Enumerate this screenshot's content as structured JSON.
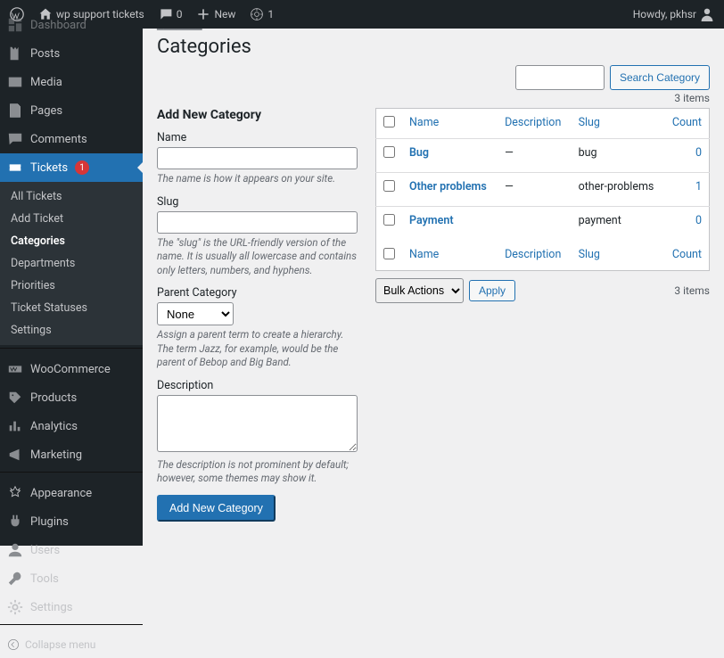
{
  "adminbar": {
    "site_name": "wp support tickets",
    "comments_count": "0",
    "new_label": "New",
    "user_count": "1",
    "greeting": "Howdy, pkhsr"
  },
  "sidebar": {
    "items": [
      {
        "label": "Dashboard",
        "icon": "dashboard"
      },
      {
        "label": "Posts",
        "icon": "posts"
      },
      {
        "label": "Media",
        "icon": "media"
      },
      {
        "label": "Pages",
        "icon": "pages"
      },
      {
        "label": "Comments",
        "icon": "comments"
      },
      {
        "label": "Tickets",
        "icon": "tickets",
        "badge": "1",
        "current": true
      }
    ],
    "submenu": [
      {
        "label": "All Tickets"
      },
      {
        "label": "Add Ticket"
      },
      {
        "label": "Categories",
        "current": true
      },
      {
        "label": "Departments"
      },
      {
        "label": "Priorities"
      },
      {
        "label": "Ticket Statuses"
      },
      {
        "label": "Settings"
      }
    ],
    "items2": [
      {
        "label": "WooCommerce",
        "icon": "woo"
      },
      {
        "label": "Products",
        "icon": "products"
      },
      {
        "label": "Analytics",
        "icon": "analytics"
      },
      {
        "label": "Marketing",
        "icon": "marketing"
      }
    ],
    "items3": [
      {
        "label": "Appearance",
        "icon": "appearance"
      },
      {
        "label": "Plugins",
        "icon": "plugins"
      },
      {
        "label": "Users",
        "icon": "users"
      },
      {
        "label": "Tools",
        "icon": "tools"
      },
      {
        "label": "Settings",
        "icon": "settings"
      }
    ],
    "collapse": "Collapse menu"
  },
  "page": {
    "title": "Categories",
    "cut_item": "Dashboard",
    "search_button": "Search Category",
    "items_count": "3 items",
    "form": {
      "heading": "Add New Category",
      "name_label": "Name",
      "name_desc": "The name is how it appears on your site.",
      "slug_label": "Slug",
      "slug_desc": "The \"slug\" is the URL-friendly version of the name. It is usually all lowercase and contains only letters, numbers, and hyphens.",
      "parent_label": "Parent Category",
      "parent_selected": "None",
      "parent_desc": "Assign a parent term to create a hierarchy. The term Jazz, for example, would be the parent of Bebop and Big Band.",
      "desc_label": "Description",
      "desc_desc": "The description is not prominent by default; however, some themes may show it.",
      "submit": "Add New Category"
    },
    "table": {
      "headers": {
        "name": "Name",
        "description": "Description",
        "slug": "Slug",
        "count": "Count"
      },
      "rows": [
        {
          "name": "Bug",
          "description": "—",
          "slug": "bug",
          "count": "0"
        },
        {
          "name": "Other problems",
          "description": "—",
          "slug": "other-problems",
          "count": "1"
        },
        {
          "name": "Payment",
          "description": "",
          "slug": "payment",
          "count": "0"
        }
      ]
    },
    "bulk": {
      "selected": "Bulk Actions",
      "apply": "Apply"
    }
  }
}
